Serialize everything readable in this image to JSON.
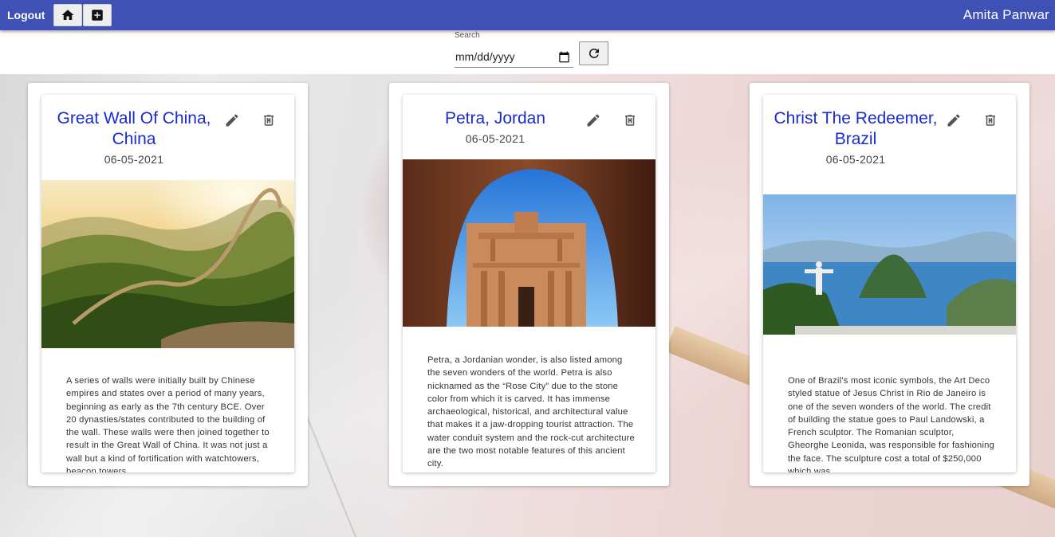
{
  "header": {
    "logout_label": "Logout",
    "user_name": "Amita Panwar",
    "accent": "#3f51b5"
  },
  "search": {
    "label": "Search",
    "date_placeholder": "mm/dd/yyyy"
  },
  "cards": [
    {
      "title": "Great Wall Of China, China",
      "date": "06-05-2021",
      "description": "A series of walls were initially built by Chinese empires and states over a period of many years, beginning as early as the 7th century BCE. Over 20 dynasties/states contributed to the building of the wall. These walls were then joined together to result in the Great Wall of China. It was not just a wall but a kind of fortification with watchtowers, beacon towers"
    },
    {
      "title": "Petra, Jordan",
      "date": "06-05-2021",
      "description": "Petra, a Jordanian wonder, is also listed among the seven wonders of the world. Petra is also nicknamed as the “Rose City” due to the stone color from which it is carved. It has immense archaeological, historical, and architectural value that makes it a jaw-dropping tourist attraction. The water conduit system and the rock-cut architecture are the two most notable features of this ancient city."
    },
    {
      "title": "Christ The Redeemer, Brazil",
      "date": "06-05-2021",
      "description": "One of Brazil’s most iconic symbols, the Art Deco styled statue of Jesus Christ in Rio de Janeiro is one of the seven wonders of the world. The credit of building the statue goes to Paul Landowski, a French sculptor. The Romanian sculptor, Gheorghe Leonida, was responsible for fashioning the face. The sculpture cost a total of $250,000 which was"
    }
  ]
}
